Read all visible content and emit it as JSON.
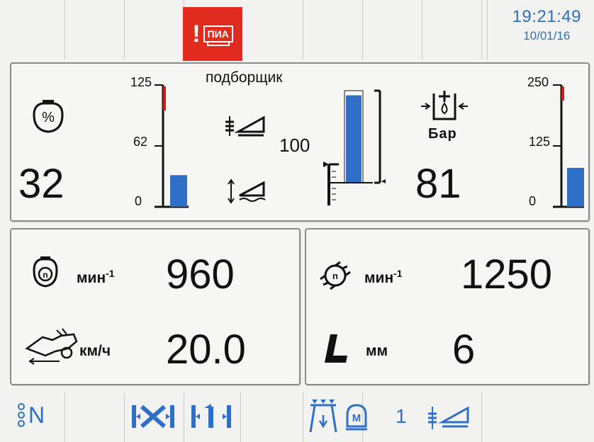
{
  "header": {
    "alarm_label": "ПИА",
    "time": "19:21:49",
    "date": "10/01/16"
  },
  "top_panel": {
    "left_value": "32",
    "left_scale": {
      "max": "125",
      "mid": "62",
      "min": "0",
      "fill_fraction": 0.26
    },
    "pickup_title": "подборщик",
    "pickup_value": "100",
    "pickup_bar_fraction": 0.95,
    "right_value": "81",
    "pressure_unit": "Бар",
    "right_scale": {
      "max": "250",
      "mid": "125",
      "min": "0",
      "fill_fraction": 0.32
    }
  },
  "panel_engine": {
    "rpm_unit": "мин",
    "rpm_exp": "-1",
    "rpm_value": "960",
    "speed_unit": "км/ч",
    "speed_value": "20.0"
  },
  "panel_rotor": {
    "rpm_unit": "мин",
    "rpm_exp": "-1",
    "rpm_value": "1250",
    "length_unit": "мм",
    "length_value": "6"
  },
  "bottom_bar": {
    "b1_label": "N",
    "b5_suffix": "1"
  },
  "colors": {
    "accent_blue": "#2f6fc8",
    "alarm_red": "#e22b1f",
    "warning_red": "#c8211b"
  }
}
